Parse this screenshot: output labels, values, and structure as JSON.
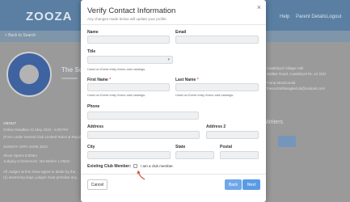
{
  "background": {
    "logo": "ZOOZA",
    "nav_links": [
      "Help",
      "Parent Details",
      "Logout"
    ],
    "breadcrumb": "< Back to Search",
    "club_title": "The Scotti...",
    "address_lines": [
      "Castlebyrd Village Hall",
      "Walker Road, Castlebyrd RL 12 3CD"
    ],
    "contact_lines": [
      "Fiona MacDonald",
      "thesocttishbeagleclub@outlook.com"
    ],
    "left_texts": [
      "ABOUT",
      "Online Deadline 21 May 2022 - 5:00 PM",
      "(Form under Kennel Club Limited Rules & Regula...",
      "SUNDAY 19TH JUNE 2022",
      "Show Opens 9:00am",
      "Judging Commences: Not Before 1.00pm",
      "All Judges at this show agree to abide by the...",
      "(1) assessing dogs, judges must penalise any..."
    ],
    "right_heading": "Writers"
  },
  "modal": {
    "title": "Verify Contact Information",
    "subtitle": "Any changes made below will update your profile.",
    "close_label": "×",
    "fields": {
      "name": {
        "label": "Name",
        "value": ""
      },
      "email": {
        "label": "Email",
        "value": ""
      },
      "title": {
        "label": "Title",
        "value": "",
        "hint": "Used on Event entry forms and catalogs."
      },
      "first_name": {
        "label": "First Name",
        "required_mark": "*",
        "value": "",
        "hint": "Used on Event entry forms and catalogs."
      },
      "last_name": {
        "label": "Last Name",
        "required_mark": "*",
        "value": "",
        "hint": "Used on Event entry forms and catalogs."
      },
      "phone": {
        "label": "Phone",
        "value": ""
      },
      "address": {
        "label": "Address",
        "value": ""
      },
      "address2": {
        "label": "Address 2",
        "value": ""
      },
      "city": {
        "label": "City",
        "value": ""
      },
      "state": {
        "label": "State",
        "value": ""
      },
      "postal": {
        "label": "Postal",
        "value": ""
      }
    },
    "existing_club_member": {
      "label": "Existing Club Member:",
      "checkbox_label": "I am a club member.",
      "checked": false
    },
    "buttons": {
      "cancel": "Cancel",
      "back": "Back",
      "next": "Next"
    },
    "colors": {
      "primary": "#5a9be6",
      "required": "#d9534f"
    }
  }
}
